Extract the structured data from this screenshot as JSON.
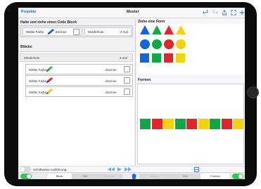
{
  "nav": {
    "back_link": "Projekte",
    "title": "Muster",
    "icons": [
      "undo-icon",
      "redo-icon",
      "share-icon",
      "fullscreen-icon",
      "add-icon"
    ]
  },
  "left": {
    "drag_title": "Halte und ziehe einen Code Block",
    "code_block": {
      "choose_color": "Wähle Farbe",
      "draw": "Zeichne",
      "repeat": "Wiederhole",
      "repeat_count": "2 mal"
    },
    "blocks_title": "Blöcke",
    "repeat_row": {
      "label": "Wiederhole",
      "count": "3 mal"
    },
    "block_rows": [
      {
        "label": "Wähle Farbe",
        "pencil_color": "#2bb24c",
        "action": "Zeichne"
      },
      {
        "label": "Wähle Farbe",
        "pencil_color": "#e0262b",
        "action": "Zeichne"
      },
      {
        "label": "Wähle Farbe",
        "pencil_color": "#f3c51a",
        "action": "Zeichne"
      }
    ]
  },
  "right": {
    "drag_form_title": "Ziehe eine Form",
    "forms_title": "Formen",
    "palette_colors": [
      "#1565d8",
      "#12a64a",
      "#e0262b",
      "#f3d20f"
    ],
    "palette_rows": [
      "triangle",
      "circle",
      "square"
    ],
    "result_colors": [
      "#12a64a",
      "#e0262b",
      "#f3d20f",
      "#12a64a",
      "#e0262b",
      "#f3d20f",
      "#12a64a",
      "#e0262b",
      "#f3d20f"
    ]
  },
  "controls": {
    "step_label": "Schrittweise Ausführung"
  },
  "tabbar": {
    "left_segments": [
      "Block",
      "Text",
      "Formen"
    ],
    "right_segments": [
      "Block",
      "Text",
      "Formen"
    ],
    "colors": {
      "toggle_on": "#34c759",
      "accent": "#2166d6"
    }
  }
}
